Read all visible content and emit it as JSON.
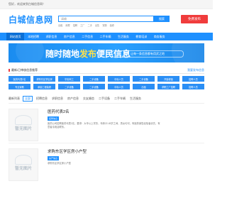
{
  "topbar": {
    "welcome": "您好，欢迎来到白城信息网！"
  },
  "header": {
    "logo": "白城信息网",
    "search_placeholder": "请输",
    "search_button": "搜索",
    "hot_keywords": [
      "出租",
      "房屋",
      "招聘",
      "工厂",
      "二手",
      "出售",
      "宠物",
      "装修"
    ],
    "post_button": "免费发布"
  },
  "nav": {
    "items": [
      "网站首页",
      "本地招聘",
      "求职信息",
      "房产信息",
      "二手信息",
      "二手车辆",
      "生活服务",
      "教育培训",
      "商务服务"
    ]
  },
  "banner": {
    "main_prefix": "随时随地",
    "main_highlight": "发布",
    "main_suffix": "便民信息",
    "sub": "让每一条信息都有用武之地"
  },
  "categories_section": {
    "title": "最新/已审核信息推荐",
    "more_link": "我要发布信息",
    "items": [
      "医药代表2名",
      "求购东区学区房",
      "华安科工",
      "二手设备",
      "中标人员",
      "二手设备",
      "开锁修锁",
      "招聘人员",
      "专业家教",
      "承接工程装修",
      "二手设备",
      "二手设备",
      "中标人员",
      "出租",
      "求职工厂招聘",
      "招聘人员"
    ]
  },
  "filter": {
    "label": "最新列表",
    "chips": [
      "全部",
      "招聘信息",
      "求职信息",
      "房产信息",
      "交友婚恋",
      "二手设备",
      "二手车辆",
      "生活服务"
    ],
    "active_index": 0
  },
  "listings": [
    {
      "placeholder": "暂无图片",
      "title": "医药代表2名",
      "badge": "招聘信息",
      "desc": "医药公司招聘医药代表2名，要求：大专以上学历，年龄22-45岁之间，男女均可，有医药销售经验者优先，有意者请电话联系。"
    },
    {
      "placeholder": "暂无图片",
      "title": "求购东区学区房小户型",
      "badge": "房产信息",
      "desc": "求购东区学区房小户型"
    }
  ]
}
